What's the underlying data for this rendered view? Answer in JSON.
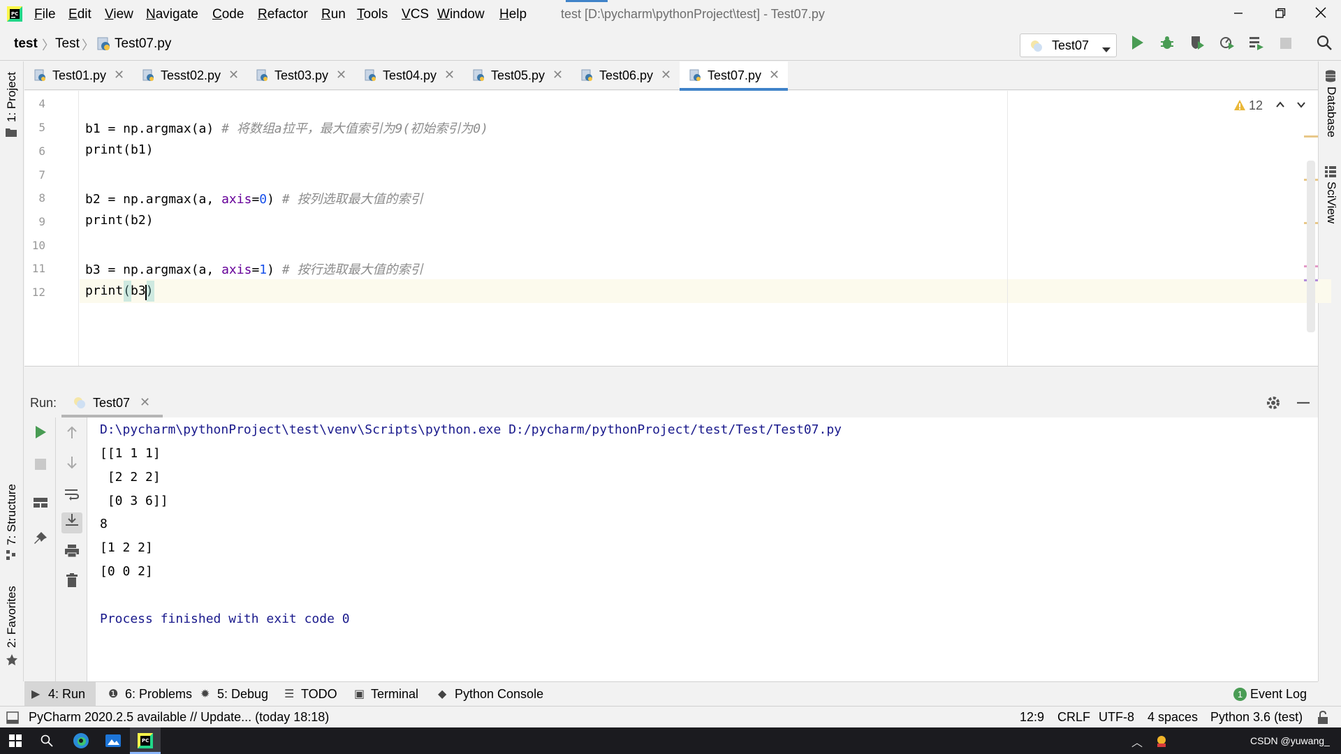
{
  "app": {
    "title": "test [D:\\pycharm\\pythonProject\\test] - Test07.py",
    "menu": [
      "File",
      "Edit",
      "View",
      "Navigate",
      "Code",
      "Refactor",
      "Run",
      "Tools",
      "VCS",
      "Window",
      "Help"
    ]
  },
  "breadcrumb": [
    "test",
    "Test",
    "Test07.py"
  ],
  "run_config": {
    "label": "Test07"
  },
  "left_strip": {
    "project": "1: Project",
    "structure": "7: Structure",
    "favorites": "2: Favorites"
  },
  "right_strip": {
    "database": "Database",
    "sciview": "SciView"
  },
  "tabs": [
    {
      "label": "Test01.py"
    },
    {
      "label": "Tesst02.py"
    },
    {
      "label": "Test03.py"
    },
    {
      "label": "Test04.py"
    },
    {
      "label": "Test05.py"
    },
    {
      "label": "Test06.py"
    },
    {
      "label": "Test07.py",
      "active": true
    }
  ],
  "editor": {
    "warnings": "12",
    "lines": [
      {
        "num": "4"
      },
      {
        "num": "5",
        "code": "b1 = np.argmax(a)",
        "comment": "# 将数组a拉平，最大值索引为9(初始索引为0)"
      },
      {
        "num": "6",
        "code": "print(b1)"
      },
      {
        "num": "7"
      },
      {
        "num": "8",
        "code_pre": "b2 = np.argmax(a, ",
        "kw": "axis",
        "eq": "=",
        "val": "0",
        "close": ")",
        "comment": "# 按列选取最大值的索引"
      },
      {
        "num": "9",
        "code": "print(b2)"
      },
      {
        "num": "10"
      },
      {
        "num": "11",
        "code_pre": "b3 = np.argmax(a, ",
        "kw": "axis",
        "eq": "=",
        "val": "1",
        "close": ")",
        "comment": "# 按行选取最大值的索引"
      },
      {
        "num": "12",
        "code": "print(b3)"
      }
    ]
  },
  "run": {
    "label": "Run:",
    "tab": "Test07",
    "output": [
      "D:\\pycharm\\pythonProject\\test\\venv\\Scripts\\python.exe D:/pycharm/pythonProject/test/Test/Test07.py",
      "[[1 1 1]",
      " [2 2 2]",
      " [0 3 6]]",
      "8",
      "[1 2 2]",
      "[0 0 2]",
      "",
      "Process finished with exit code 0"
    ]
  },
  "bottom_tabs": [
    {
      "label": "4: Run",
      "icon": "play-icon",
      "active": true
    },
    {
      "label": "6: Problems",
      "icon": "problems-icon"
    },
    {
      "label": "5: Debug",
      "icon": "bug-icon"
    },
    {
      "label": "TODO",
      "icon": "list-icon"
    },
    {
      "label": "Terminal",
      "icon": "terminal-icon"
    },
    {
      "label": "Python Console",
      "icon": "python-icon"
    }
  ],
  "event_log": {
    "label": "Event Log",
    "count": "1"
  },
  "status": {
    "message": "PyCharm 2020.2.5 available // Update... (today 18:18)",
    "position": "12:9",
    "line_sep": "CRLF",
    "encoding": "UTF-8",
    "indent": "4 spaces",
    "interpreter": "Python 3.6 (test)"
  },
  "taskbar": {
    "tray_text": "CSDN @yuwang_"
  },
  "colors": {
    "accent": "#4083c9",
    "run_green": "#499c54",
    "output_blue": "#1a1a8c"
  }
}
